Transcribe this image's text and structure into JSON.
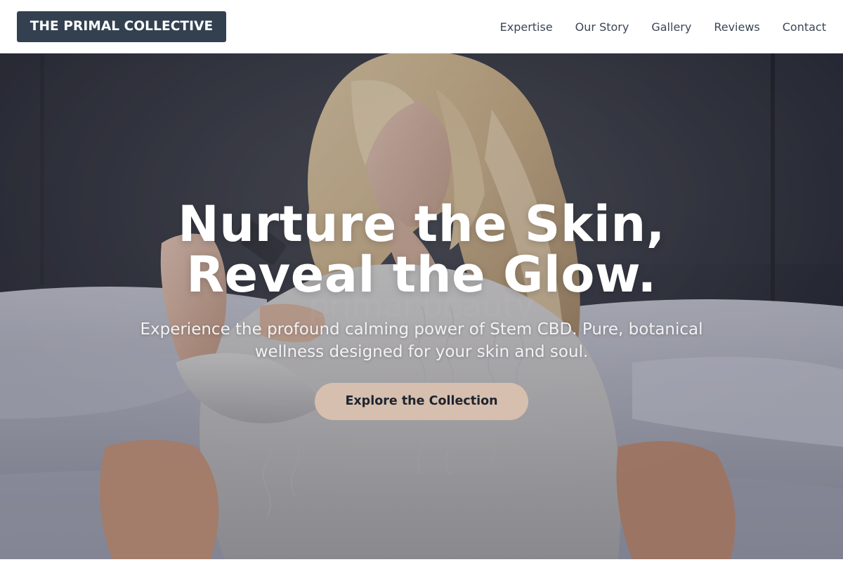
{
  "brand": {
    "name": "THE PRIMAL COLLECTIVE"
  },
  "nav": {
    "items": [
      "Expertise",
      "Our Story",
      "Gallery",
      "Reviews",
      "Contact"
    ]
  },
  "hero": {
    "headline_line1": "Nurture the Skin,",
    "headline_line2": "Reveal the Glow.",
    "subtext": "Experience the profound calming power of Stem CBD. Pure, botanical wellness designed for your skin and soul.",
    "cta_label": "Explore the Collection",
    "background_description": "woman-with-cbd-dropper-photo"
  },
  "colors": {
    "logo_bg": "#334050",
    "nav_text": "#3b4654",
    "cta_bg": "#d6bfae",
    "cta_text": "#1f2430",
    "hero_text": "#ffffff"
  }
}
